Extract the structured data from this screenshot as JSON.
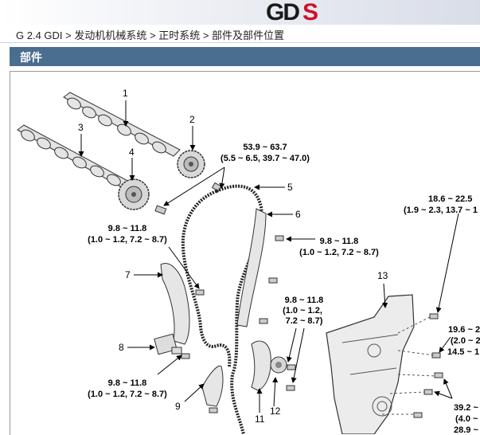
{
  "header": {
    "logo_text": "GDS"
  },
  "breadcrumb": {
    "model": "G 2.4 GDI",
    "sep": " > ",
    "level1": "发动机机械系统",
    "level2": "正时系统",
    "level3": "部件及部件位置"
  },
  "section": {
    "title": "部件"
  },
  "diagram": {
    "callouts": [
      "1",
      "2",
      "3",
      "4",
      "5",
      "6",
      "7",
      "8",
      "9",
      "11",
      "12",
      "13"
    ],
    "torque_specs": {
      "t1_main": "53.9 ~ 63.7",
      "t1_sub": "(5.5 ~ 6.5, 39.7 ~ 47.0)",
      "t2_main": "9.8 ~ 11.8",
      "t2_sub": "(1.0 ~ 1.2, 7.2 ~ 8.7)",
      "t3_main": "9.8 ~ 11.8",
      "t3_sub": "(1.0 ~ 1.2, 7.2 ~ 8.7)",
      "t4_main": "9.8 ~ 11.8",
      "t4_sub1": "(1.0 ~ 1.2,",
      "t4_sub2": "7.2 ~ 8.7)",
      "t5_main": "9.8 ~ 11.8",
      "t5_sub": "(1.0 ~ 1.2, 7.2 ~ 8.7)",
      "t6_main": "18.6 ~ 22.5",
      "t6_sub": "(1.9 ~ 2.3, 13.7 ~ 1",
      "t7_main": "19.6 ~ 2",
      "t7_sub1": "(2.0 ~ 2",
      "t7_sub2": "14.5 ~ 1",
      "t8_main": "39.2 ~",
      "t8_sub1": "(4.0 ~",
      "t8_sub2": "28.9 ~"
    }
  }
}
